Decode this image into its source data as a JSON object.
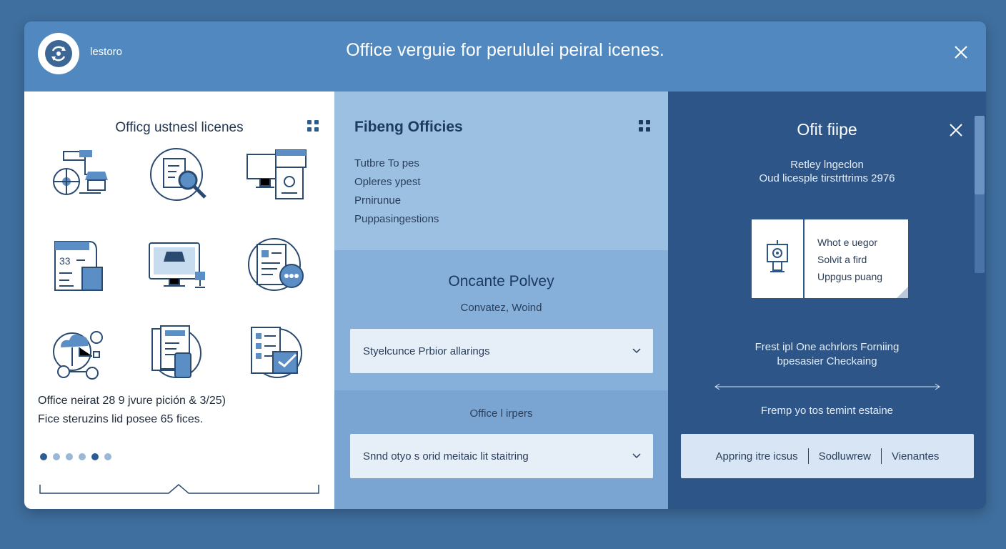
{
  "window": {
    "app_name": "lestoro",
    "title": "Office verguie for  perululei peiral  icenes.",
    "logo_icon": "cycle-arrows-icon"
  },
  "left_panel": {
    "title": "Officg ustnesl licenes",
    "icons": [
      "network-devices-icon",
      "document-search-icon",
      "monitor-settings-icon",
      "calendar-document-icon",
      "desktop-computer-icon",
      "document-options-icon",
      "cloud-network-icon",
      "documents-mobile-icon",
      "document-certificate-icon"
    ],
    "text_line1": "Office neirat  28 9 jvure pición & 3/25)",
    "text_line2": "Fice steruzins lid posee 65 fices.",
    "dots_count": 6,
    "active_dots": [
      0,
      4
    ]
  },
  "middle_panel": {
    "heading": "Fibeng Officies",
    "list": [
      "Tutbre To pes",
      "Opleres ypest",
      "Prnirunue",
      "Puppasingestions"
    ],
    "section_title": "Oncante Polvey",
    "section_subtitle": "Convatez, Woind",
    "select1_value": "Styelcunce Prbior allarings",
    "section3_label": "Office l irpers",
    "select2_value": "Snnd otyo s orid meitaic lit staitring"
  },
  "right_panel": {
    "title": "Ofit fiipe",
    "sub_line1": "Retley lngeclon",
    "sub_line2": "Oud licesple tirstrttrims 2976",
    "card_lines": [
      "Whot e uegor",
      "Solvit a fird",
      "Uppgus puang"
    ],
    "card_icon": "easel-target-icon",
    "desc_line1": "Frest ipl One achrlors Forniing",
    "desc_line2": "bpesasier Checkaing",
    "footer_text": "Fremp yo tos temint estaine",
    "segments": [
      "Appring itre icsus",
      "Sodluwrew",
      "Vienantes"
    ]
  },
  "colors": {
    "background": "#3f6f9f",
    "titlebar": "#5088bf",
    "middle_top": "#9bc0e2",
    "right_panel": "#2d5587",
    "accent": "#2b5c94"
  }
}
